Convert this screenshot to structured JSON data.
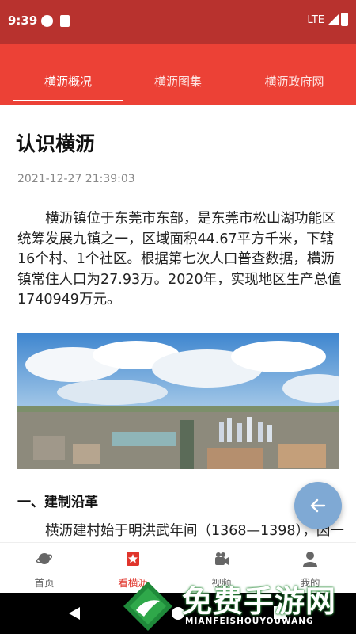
{
  "status_bar": {
    "time": "9:39",
    "network": "LTE"
  },
  "tabs": [
    {
      "label": "横沥概况",
      "active": true
    },
    {
      "label": "横沥图集",
      "active": false
    },
    {
      "label": "横沥政府网",
      "active": false
    }
  ],
  "article": {
    "title": "认识横沥",
    "date": "2021-12-27 21:39:03",
    "intro": "横沥镇位于东莞市东部，是东莞市松山湖功能区统筹发展九镇之一，区域面积44.67平方千米，下辖16个村、1个社区。根据第七次人口普查数据，横沥镇常住人口为27.93万。2020年，实现地区生产总值1740949万元。",
    "section_heading": "一、建制沿革",
    "section_text": "横沥建村始于明洪武年间（1368—1398），因一"
  },
  "bottom_nav": [
    {
      "label": "首页",
      "icon": "planet-icon",
      "active": false
    },
    {
      "label": "看横沥",
      "icon": "star-bookmark-icon",
      "active": true
    },
    {
      "label": "视频",
      "icon": "video-camera-icon",
      "active": false
    },
    {
      "label": "我的",
      "icon": "person-icon",
      "active": false
    }
  ],
  "watermark": {
    "title": "免费手游网",
    "subtitle": "MIANFEISHOUYOUWANG"
  },
  "colors": {
    "status_bar": "#b8322e",
    "tab_bar": "#ec4136",
    "active_nav": "#e0352c",
    "fab": "#7fa9d4"
  }
}
